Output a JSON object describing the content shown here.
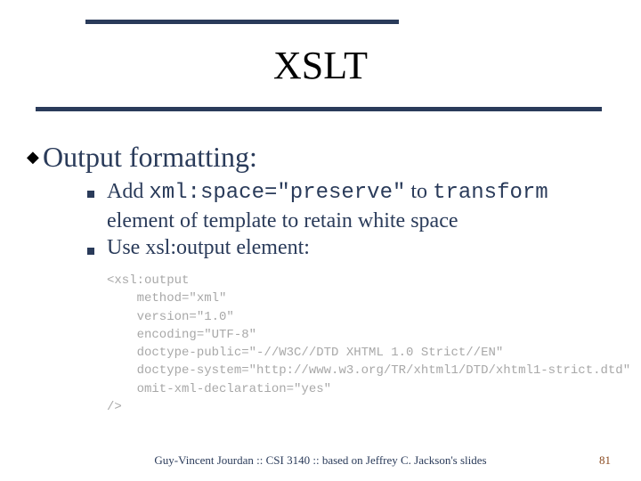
{
  "title": "XSLT",
  "heading": "Output formatting:",
  "bullet1": {
    "pre": "Add ",
    "code1": "xml:space=\"preserve\"",
    "mid": " to ",
    "code2": "transform",
    "post": " element of template to retain white space"
  },
  "bullet2": "Use xsl:output element:",
  "code": {
    "l1": "<xsl:output",
    "l2": "    method=\"xml\"",
    "l3": "    version=\"1.0\"",
    "l4": "    encoding=\"UTF-8\"",
    "l5": "    doctype-public=\"-//W3C//DTD XHTML 1.0 Strict//EN\"",
    "l6": "    doctype-system=\"http://www.w3.org/TR/xhtml1/DTD/xhtml1-strict.dtd\"",
    "l7": "    omit-xml-declaration=\"yes\"",
    "l8": "/>"
  },
  "footer": "Guy-Vincent Jourdan :: CSI 3140 :: based on Jeffrey C. Jackson's slides",
  "page": "81"
}
